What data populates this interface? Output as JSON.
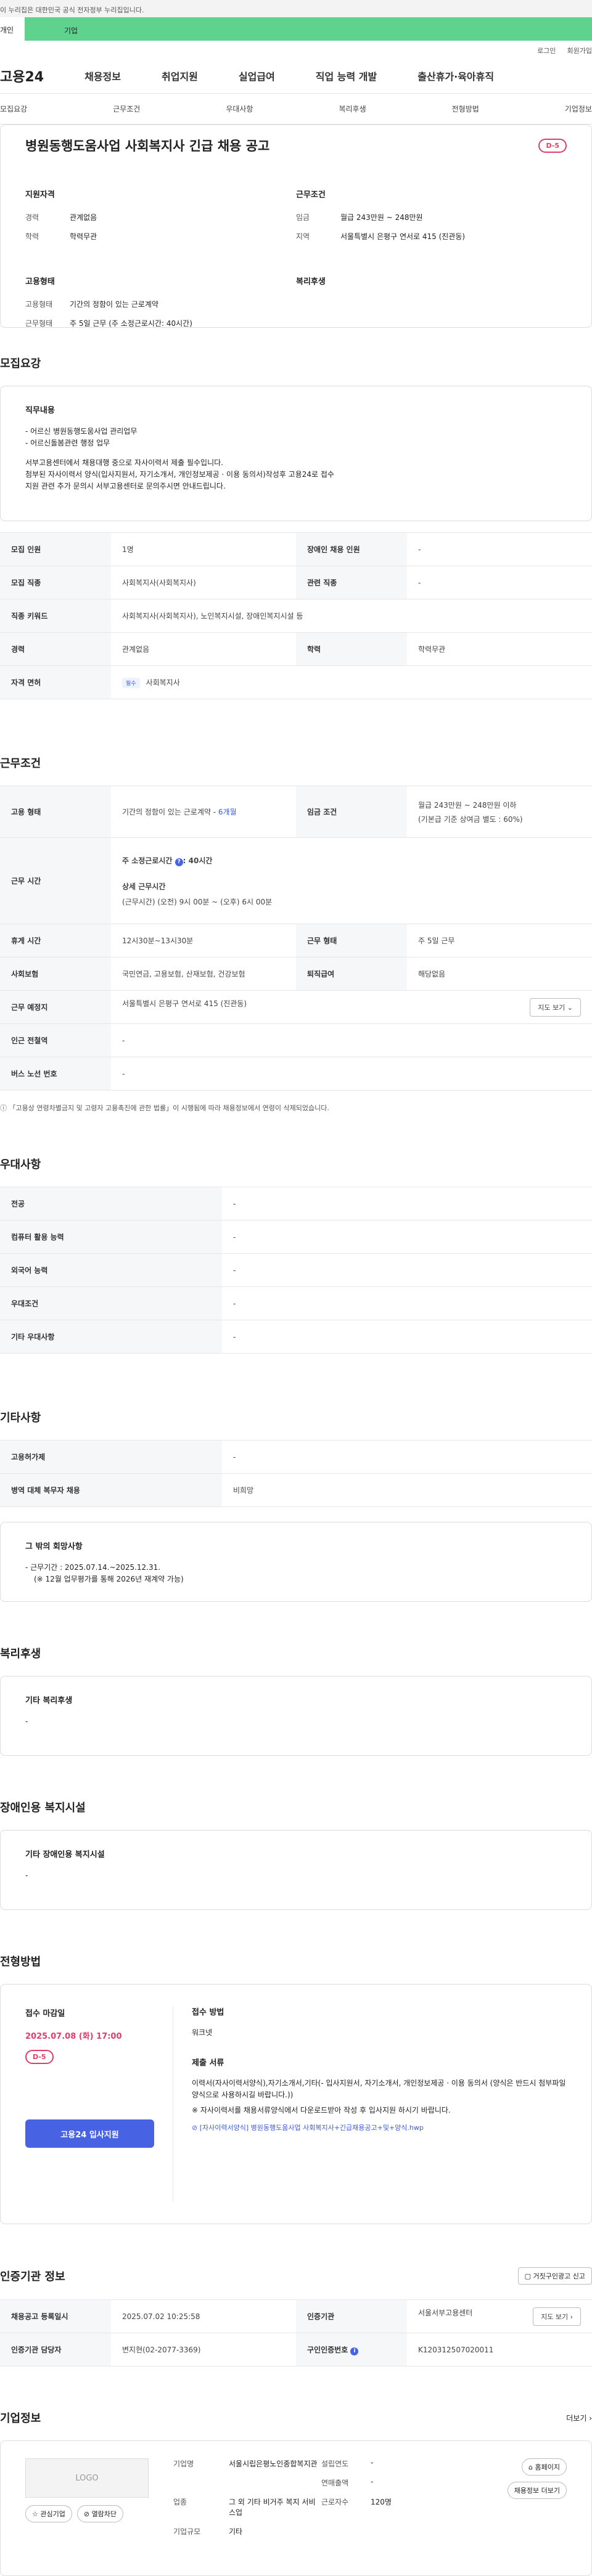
{
  "top": {
    "notice": "이 누리집은 대한민국 공식 전자정부 누리집입니다.",
    "left_label": "개인",
    "right_label": "기업",
    "login": "로그인",
    "signup": "회원가입"
  },
  "gnb": {
    "logo": "고용24",
    "menus": [
      "채용정보",
      "취업지원",
      "실업급여",
      "직업 능력 개발",
      "출산휴가·육아휴직"
    ]
  },
  "tabs": [
    "모집요강",
    "근무조건",
    "우대사항",
    "복리후생",
    "전형방법",
    "기업정보"
  ],
  "job": {
    "title": "병원동행도움사업 사회복지사 긴급 채용 공고",
    "dday": "D-5",
    "qualification_head": "지원자격",
    "experience_k": "경력",
    "experience_v": "관계없음",
    "education_k": "학력",
    "education_v": "학력무관",
    "condition_head": "근무조건",
    "wage_k": "임금",
    "wage_v": "월급 243만원 ~ 248만원",
    "area_k": "지역",
    "area_v": "서울특별시 은평구 연서로 415 (진관동)",
    "employ_head": "고용형태",
    "employ_k": "고용형태",
    "employ_v": "기간의 정함이 있는 근로계약",
    "workform_k": "근무형태",
    "workform_v": "주 5일 근무 (주 소정근로시간: 40시간)",
    "welfare_head": "복리후생"
  },
  "recruit": {
    "section": "모집요강",
    "duty_title": "직무내용",
    "duty_lines": [
      "- 어르신 병원동행도움사업 관리업무",
      "- 어르신돌봄관련 행정 업무",
      "",
      "서부고용센터에서 채용대행 중으로 자사이력서 제출 필수입니다.",
      "첨부된 자사이력서 양식(입사지원서, 자기소개서, 개인정보제공 · 이용 동의서)작성후 고용24로 접수",
      "지원 관련 추가 문의시 서부고용센터로 문의주시면 안내드립니다."
    ],
    "rows": [
      {
        "k1": "모집 인원",
        "v1": "1명",
        "k2": "장애인 채용 인원",
        "v2": "-"
      },
      {
        "k1": "모집 직종",
        "v1": "사회복지사(사회복지사)",
        "k2": "관련 직종",
        "v2": "-"
      },
      {
        "k1": "직종 키워드",
        "v1": "사회복지사(사회복지사), 노인복지시설, 장애인복지시설 등",
        "k2": "",
        "v2": ""
      },
      {
        "k1": "경력",
        "v1": "관계없음",
        "k2": "학력",
        "v2": "학력무관"
      },
      {
        "k1": "자격 면허",
        "v1": "사회복지사",
        "tag": "필수",
        "k2": "",
        "v2": ""
      }
    ]
  },
  "conditions": {
    "section": "근무조건",
    "employ_k": "고용 형태",
    "employ_v": "기간의 정함이 있는 근로계약 - ",
    "employ_months": "6개월",
    "wage_k": "임금 조건",
    "wage_v1": "월급 243만원 ~ 248만원 이하",
    "wage_v2": "(기본급 기준 상여금 별도 : 60%)",
    "hours_k": "근무 시간",
    "hours_main": "주 소정근로시간 ",
    "hours_main_v": ": 40시간",
    "hours_detail_title": "상세 근무시간",
    "hours_detail": "(근무시간) (오전) 9시 00분 ~ (오후) 6시 00분",
    "break_k": "휴게 시간",
    "break_v": "12시30분~13시30분",
    "form_k": "근무 형태",
    "form_v": "주 5일 근무",
    "insurance_k": "사회보험",
    "insurance_v": "국민연금, 고용보험, 산재보험, 건강보험",
    "severance_k": "퇴직급여",
    "severance_v": "해당없음",
    "place_k": "근무 예정지",
    "place_v": "서울특별시 은평구 연서로 415 (진관동)",
    "map_btn": "지도 보기",
    "subway_k": "인근 전철역",
    "subway_v": "-",
    "bus_k": "버스 노선 번호",
    "bus_v": "-",
    "footnote": "「고용상 연령차별금지 및 고령자 고용촉진에 관한 법률」이 시행됨에 따라 채용정보에서 연령이 삭제되었습니다."
  },
  "preferences": {
    "section": "우대사항",
    "rows": [
      {
        "k": "전공",
        "v": "-"
      },
      {
        "k": "컴퓨터 활용 능력",
        "v": "-"
      },
      {
        "k": "외국어 능력",
        "v": "-"
      },
      {
        "k": "우대조건",
        "v": "-"
      },
      {
        "k": "기타 우대사항",
        "v": "-"
      }
    ]
  },
  "others": {
    "section": "기타사항",
    "rows": [
      {
        "k": "고용허가제",
        "v": "-"
      },
      {
        "k": "병역 대체 복무자 채용",
        "v": "비희망"
      }
    ],
    "box_title": "그 밖의 회망사항",
    "box_line1": "- 근무기간 : 2025.07.14.~2025.12.31.",
    "box_line2": "(※ 12월 업무평가를 통해 2026년 재계약 가능)"
  },
  "welfare": {
    "section": "복리후생",
    "box_title": "기타 복리후생",
    "box_value": "-"
  },
  "disability": {
    "section": "장애인용 복지시설",
    "box_title": "기타 장애인용 복지시설",
    "box_value": "-"
  },
  "process": {
    "section": "전형방법",
    "deadline_title": "접수 마감일",
    "deadline": "2025.07.08 (화) 17:00",
    "dday": "D-5",
    "apply_btn": "고용24 입사지원",
    "method_title": "접수 방법",
    "method": "워크넷",
    "docs_title": "제출 서류",
    "docs_1": "이력서(자사이력서양식),자기소개서,기타(- 입사지원서, 자기소개서, 개인정보제공 · 이용 동의서 (양식은 반드시 첨부파일 양식으로 사용하시길 바랍니다.))",
    "docs_2": "※ 자사이력서를 채용서류양식에서 다운로드받아 작성 후 입사지원 하시기 바랍니다.",
    "file": "[자사이력서양식] 병원동행도움사업 사회복지사+긴급채용공고+및+양식.hwp"
  },
  "agency": {
    "section": "인증기관 정보",
    "report_btn": "거짓구인광고 신고",
    "reg_k": "채용공고 등록일시",
    "reg_v": "2025.07.02 10:25:58",
    "org_k": "인증기관",
    "org_v": "서울서부고용센터",
    "map_btn": "지도 보기",
    "manager_k": "인증기관 담당자",
    "manager_v": "변지현(02-2077-3369)",
    "cert_k": "구인인증번호",
    "cert_v": "K120312507020011"
  },
  "company": {
    "section": "기업정보",
    "more": "더보기",
    "logo": "LOGO",
    "fav_btn": "관심기업",
    "block_btn": "열람차단",
    "name_k": "기업명",
    "name_v": "서울시립은평노인종합복지관",
    "found_k": "설립연도",
    "found_v": "-",
    "sales_k": "연매출액",
    "sales_v": "-",
    "industry_k": "업종",
    "industry_v": "그 외 기타 비거주 복지 서비스업",
    "workers_k": "근로자수",
    "workers_v": "120명",
    "size_k": "기업규모",
    "size_v": "기타",
    "home_btn": "홈페이지",
    "jobs_btn": "채용정보 더보기"
  }
}
